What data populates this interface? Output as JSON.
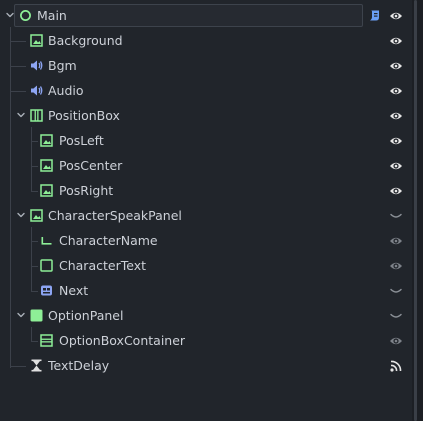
{
  "scene_tree": {
    "nodes": [
      {
        "label": "Main",
        "icon": "control-circle-icon",
        "arrow": "expanded",
        "extra": "script-icon",
        "vis": "eye-open"
      },
      {
        "label": "Background",
        "icon": "texture-rect-icon",
        "vis": "eye-open"
      },
      {
        "label": "Bgm",
        "icon": "audio-stream-player-icon",
        "vis": "eye-open"
      },
      {
        "label": "Audio",
        "icon": "audio-stream-player-icon",
        "vis": "eye-open"
      },
      {
        "label": "PositionBox",
        "icon": "hbox-container-icon",
        "arrow": "expanded",
        "vis": "eye-open"
      },
      {
        "label": "PosLeft",
        "icon": "texture-rect-icon",
        "vis": "eye-open"
      },
      {
        "label": "PosCenter",
        "icon": "texture-rect-icon",
        "vis": "eye-open"
      },
      {
        "label": "PosRight",
        "icon": "texture-rect-icon",
        "vis": "eye-open"
      },
      {
        "label": "CharacterSpeakPanel",
        "icon": "texture-rect-icon",
        "arrow": "expanded",
        "vis": "eye-closed"
      },
      {
        "label": "CharacterName",
        "icon": "label-icon",
        "vis": "eye-dim"
      },
      {
        "label": "CharacterText",
        "icon": "rich-text-label-icon",
        "vis": "eye-dim"
      },
      {
        "label": "Next",
        "icon": "scene-instance-icon",
        "vis": "eye-closed"
      },
      {
        "label": "OptionPanel",
        "icon": "panel-icon",
        "arrow": "expanded",
        "vis": "eye-closed"
      },
      {
        "label": "OptionBoxContainer",
        "icon": "vbox-container-icon",
        "vis": "eye-dim"
      },
      {
        "label": "TextDelay",
        "icon": "timer-icon",
        "vis": "signal-icon"
      }
    ]
  },
  "colors": {
    "background": "#21252b",
    "green": "#8eef97",
    "blue": "#8da5f3",
    "eye": "#e0e0e0",
    "eye_dim": "#8a8f96",
    "script": "#6a9ff5"
  }
}
